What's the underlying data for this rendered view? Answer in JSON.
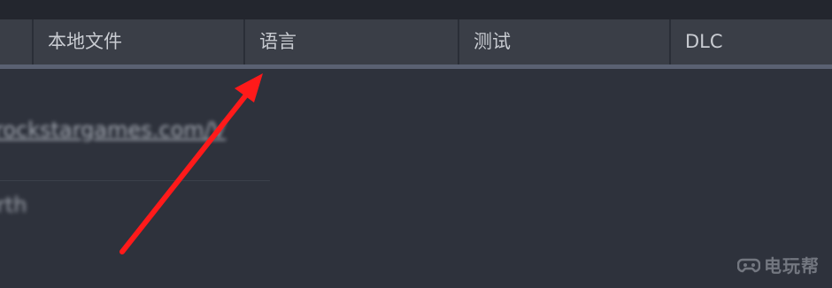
{
  "tabs": [
    {
      "label": ""
    },
    {
      "label": "本地文件"
    },
    {
      "label": "语言"
    },
    {
      "label": "测试"
    },
    {
      "label": "DLC"
    }
  ],
  "content": {
    "blurred_link": "rockstargames.com/V",
    "blurred_text": "rth"
  },
  "watermark": {
    "icon": "game-controller-icon",
    "text": "电玩帮"
  },
  "colors": {
    "tab_bg": "#3a3e47",
    "tab_text": "#c9ccd2",
    "arrow": "#ff1a1a",
    "panel_bg": "#2e323c"
  }
}
